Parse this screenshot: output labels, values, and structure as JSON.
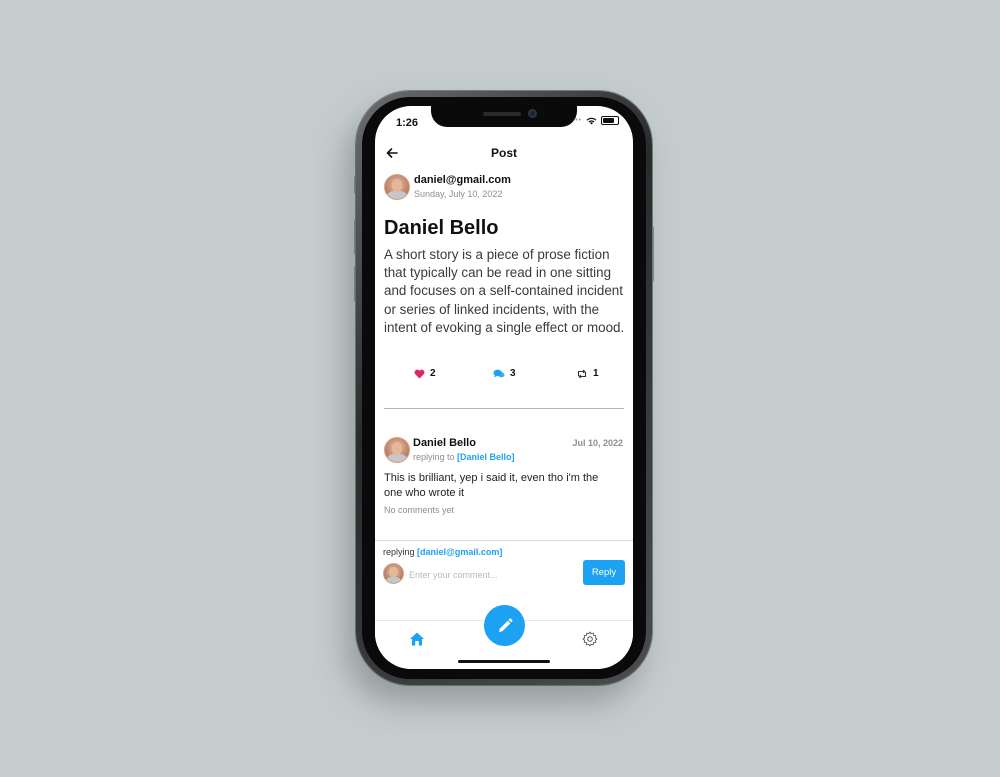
{
  "status_bar": {
    "time": "1:26"
  },
  "header": {
    "title": "Post"
  },
  "post": {
    "author_email": "daniel@gmail.com",
    "date": "Sunday, July 10, 2022",
    "title": "Daniel Bello",
    "body": "A short story is a piece of prose fiction that typically can be read in one sitting and focuses on a self-contained incident or series of linked incidents, with the intent of evoking a single effect or mood.",
    "likes": "2",
    "comments": "3",
    "reposts": "1"
  },
  "reply": {
    "author_name": "Daniel Bello",
    "date": "Jul 10, 2022",
    "replying_prefix": "replying to",
    "replying_to": "[Daniel Bello]",
    "text": "This is brilliant, yep i said it, even tho i'm the one who wrote it",
    "no_comments": "No comments yet"
  },
  "composer": {
    "replying_prefix": "replying",
    "replying_to": "[daniel@gmail.com]",
    "placeholder": "Enter your comment...",
    "reply_label": "Reply"
  },
  "colors": {
    "accent": "#1da1f2",
    "like": "#e0245e",
    "background": "#c5ccce"
  },
  "icons": [
    "back-arrow-icon",
    "heart-icon",
    "comment-icon",
    "repost-icon",
    "home-icon",
    "pencil-icon",
    "gear-icon",
    "wifi-icon",
    "battery-icon"
  ]
}
